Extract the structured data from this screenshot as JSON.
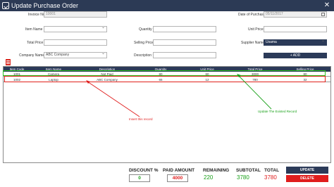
{
  "window": {
    "title": "Update Purchase Order",
    "close_glyph": "✕"
  },
  "form": {
    "invoice_no_label": "Invoice No :",
    "invoice_no_value": "10001",
    "date_label": "Date of Purchase :",
    "date_value": "05/11/2017",
    "item_name_label": "Item Name :",
    "item_name_value": "",
    "quantity_label": "Quantity :",
    "quantity_value": "",
    "unit_price_label": "Unit Price :",
    "unit_price_value": "",
    "total_price_label": "Total Price :",
    "total_price_value": "",
    "selling_price_label": "Selling Price :",
    "selling_price_value": "",
    "supplier_name_label": "Supplier Name :",
    "supplier_name_value": "Usama",
    "company_name_label": "Company Name :",
    "company_name_value": "ABC Company",
    "description_label": "Description :",
    "description_value": "",
    "add_button": "+ ADD"
  },
  "table": {
    "columns": [
      "Item Code",
      "Item Name",
      "Description",
      "Quantity",
      "Unit Price",
      "Total Price",
      "Selling Price"
    ],
    "rows": [
      [
        "1001",
        "Camera",
        "Not Paid",
        "80",
        "60",
        "3000",
        "80"
      ],
      [
        "1002",
        "Laptop",
        "ABC Company",
        "65",
        "12",
        "780",
        "32"
      ]
    ]
  },
  "annotations": {
    "insert": "Insert this record",
    "update": "Update The Existed Record"
  },
  "summary": {
    "discount_label": "DISCOUNT %",
    "discount_value": "0",
    "paid_label": "PAID AMOUNT",
    "paid_value": "4000",
    "remaining_label": "REMAINING",
    "remaining_value": "220",
    "subtotal_label": "SUBTOTAL",
    "subtotal_value": "3780",
    "total_label": "TOTAL",
    "total_value": "3780",
    "update_button": "UPDATE",
    "delete_button": "DELETE"
  },
  "colors": {
    "header": "#2b3a58",
    "green": "#1aa11a",
    "red": "#e01d1d"
  },
  "icons": [
    "window-icon",
    "close-icon",
    "calendar-icon",
    "dropdown-icon",
    "trash-icon"
  ]
}
